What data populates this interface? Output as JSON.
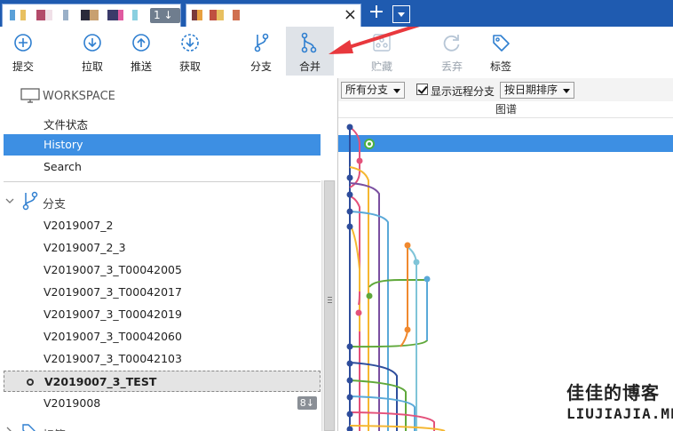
{
  "tabs": {
    "tab1_badge": "1 ↓",
    "close_glyph": "×",
    "add_glyph": "+"
  },
  "toolbar": {
    "commit": "提交",
    "pull": "拉取",
    "push": "推送",
    "fetch": "获取",
    "branch": "分支",
    "merge": "合并",
    "stash": "贮藏",
    "discard": "丢弃",
    "tag": "标签"
  },
  "sidebar": {
    "workspace_header": "WORKSPACE",
    "workspace_items": [
      "文件状态",
      "History",
      "Search"
    ],
    "branches_header": "分支",
    "branches": [
      "V2019007_2",
      "V2019007_2_3",
      "V2019007_3_T00042005",
      "V2019007_3_T00042017",
      "V2019007_3_T00042019",
      "V2019007_3_T00042060",
      "V2019007_3_T00042103",
      "V2019007_3_TEST",
      "V2019008"
    ],
    "last_badge": "8↓",
    "tags_header": "标签"
  },
  "filter": {
    "all_branches": "所有分支",
    "show_remote": "显示远程分支",
    "sort_by_date": "按日期排序",
    "graph_header": "图谱"
  },
  "watermark": {
    "line1": "佳佳的博客",
    "line2": "LIUJIAJIA.ME"
  },
  "colors": {
    "title_bar": "#1f5bb0",
    "selected": "#3d8fe3",
    "arrow": "#e8383d"
  }
}
